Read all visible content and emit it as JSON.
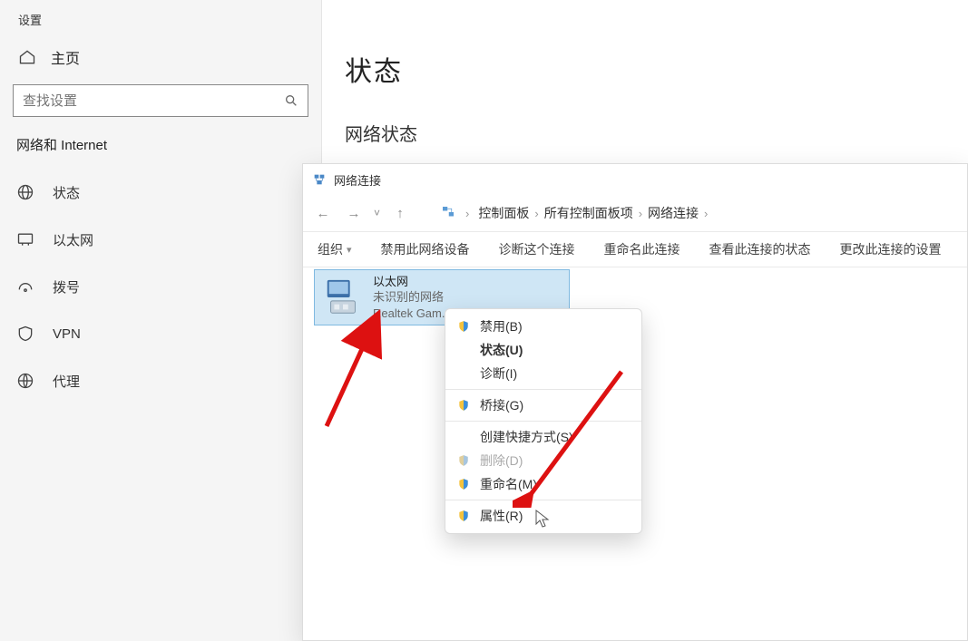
{
  "settings": {
    "header": "设置",
    "home": "主页",
    "search_placeholder": "查找设置",
    "category": "网络和 Internet",
    "items": [
      {
        "label": "状态",
        "icon": "status-icon"
      },
      {
        "label": "以太网",
        "icon": "ethernet-icon"
      },
      {
        "label": "拨号",
        "icon": "dialup-icon"
      },
      {
        "label": "VPN",
        "icon": "vpn-icon"
      },
      {
        "label": "代理",
        "icon": "proxy-icon"
      }
    ]
  },
  "main": {
    "title": "状态",
    "section": "网络状态"
  },
  "explorer": {
    "title": "网络连接",
    "nav": {
      "back": "←",
      "forward": "→",
      "up": "↑"
    },
    "breadcrumb": [
      "控制面板",
      "所有控制面板项",
      "网络连接"
    ],
    "toolbar": {
      "organize": "组织",
      "disable": "禁用此网络设备",
      "diagnose": "诊断这个连接",
      "rename": "重命名此连接",
      "viewstatus": "查看此连接的状态",
      "changeset": "更改此连接的设置"
    },
    "adapter": {
      "name": "以太网",
      "status": "未识别的网络",
      "driver": "Realtek Gam..."
    }
  },
  "context_menu": {
    "items": [
      {
        "label": "禁用(B)",
        "shield": true,
        "bold": false,
        "disabled": false
      },
      {
        "label": "状态(U)",
        "shield": false,
        "bold": true,
        "disabled": false
      },
      {
        "label": "诊断(I)",
        "shield": false,
        "bold": false,
        "disabled": false
      },
      {
        "sep": true
      },
      {
        "label": "桥接(G)",
        "shield": true,
        "bold": false,
        "disabled": false
      },
      {
        "sep": true
      },
      {
        "label": "创建快捷方式(S)",
        "shield": false,
        "bold": false,
        "disabled": false
      },
      {
        "label": "删除(D)",
        "shield": true,
        "bold": false,
        "disabled": true
      },
      {
        "label": "重命名(M)",
        "shield": true,
        "bold": false,
        "disabled": false
      },
      {
        "sep": true
      },
      {
        "label": "属性(R)",
        "shield": true,
        "bold": false,
        "disabled": false
      }
    ]
  }
}
